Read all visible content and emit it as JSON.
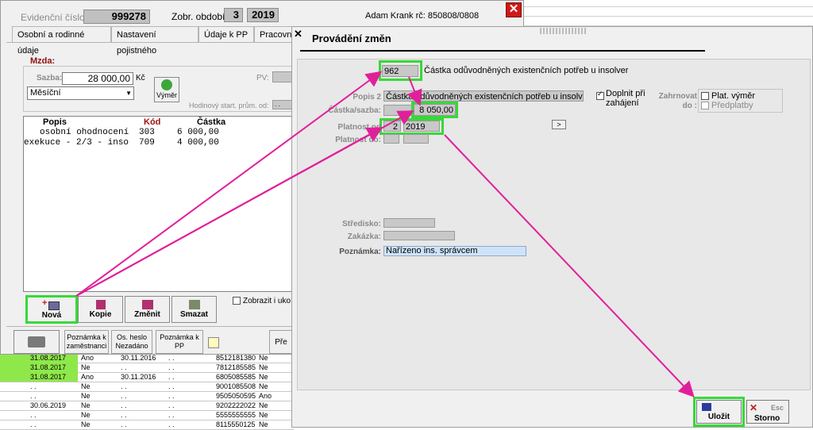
{
  "background": {
    "rows": [
      {
        "c1": "31.08.2017",
        "c2": "Ano",
        "c3": "30.11.2016",
        "c4": ". .",
        "c5": "8512181380",
        "c6": "Ne",
        "green": true
      },
      {
        "c1": "31.08.2017",
        "c2": "Ne",
        "c3": ". .",
        "c4": ". .",
        "c5": "7812185585",
        "c6": "Ne",
        "green": true
      },
      {
        "c1": "31.08.2017",
        "c2": "Ano",
        "c3": "30.11.2016",
        "c4": ". .",
        "c5": "6805085585",
        "c6": "Ne",
        "green": true
      },
      {
        "c1": ". .",
        "c2": "Ne",
        "c3": ". .",
        "c4": ". .",
        "c5": "9001085508",
        "c6": "Ne",
        "green": false
      },
      {
        "c1": ". .",
        "c2": "Ne",
        "c3": ". .",
        "c4": ". .",
        "c5": "9505050595",
        "c6": "Ano",
        "green": false
      },
      {
        "c1": "30.06.2019",
        "c2": "Ne",
        "c3": ". .",
        "c4": ". .",
        "c5": "9202222022",
        "c6": "Ne",
        "green": false
      },
      {
        "c1": ". .",
        "c2": "Ne",
        "c3": ". .",
        "c4": ". .",
        "c5": "5555555555",
        "c6": "Ne",
        "green": false
      },
      {
        "c1": ". .",
        "c2": "Ne",
        "c3": ". .",
        "c4": ". .",
        "c5": "8115550125",
        "c6": "Ne",
        "green": false
      }
    ]
  },
  "employee": {
    "evidence_label": "Evidenční číslo:",
    "evidence_number": "999278",
    "period_label": "Zobr. období:",
    "period_month": "3",
    "period_year": "2019",
    "person": "Adam Krank rč: 850808/0808"
  },
  "tabs": [
    "Osobní a rodinné údaje",
    "Nastavení pojistného",
    "Údaje k PP",
    "Pracovn"
  ],
  "mzda": {
    "title": "Mzda:",
    "rate_label": "Sazba:",
    "rate_value": "28 000,00",
    "currency": "Kč",
    "type_value": "Měsíční",
    "vymer_button": "Výměr",
    "pv_label": "PV:",
    "hourly_label": "Hodinový start. prům. od:",
    "hourly_value": ". ."
  },
  "items": {
    "headers": {
      "popis": "Popis",
      "kod": "Kód",
      "castka": "Částka"
    },
    "rows": [
      {
        "popis": "osobní ohodnocení",
        "kod": "303",
        "castka": "6 000,00"
      },
      {
        "popis": "exekuce - 2/3 - inso",
        "kod": "709",
        "castka": "4 000,00"
      }
    ]
  },
  "actions": {
    "new": "Nová",
    "copy": "Kopie",
    "change": "Změnit",
    "delete": "Smazat",
    "show_checkbox": "Zobrazit i uko"
  },
  "bottom_buttons": {
    "note_employee": "Poznámka k zaměstnanci",
    "password": "Os. heslo Nezadáno",
    "note_pp": "Poznámka k PP",
    "extra": "Pře"
  },
  "dialog": {
    "title": "Provádění změn",
    "code": "962",
    "code_desc": "Částka odůvodněných existenčních potřeb u insolver",
    "popis2_label": "Popis 2",
    "popis2_value": "Částka odůvodněných existenčních potřeb u insolve",
    "amount_label": "Částka/sazba:",
    "amount_value": "8 050,00",
    "valid_from_label": "Platnost od",
    "valid_from_month": "2",
    "valid_from_year": "2019",
    "valid_to_label": "Platnost do:",
    "next_button": ">",
    "doplnit_label": "Doplnit při zahájení",
    "zahrnovat_label": "Zahrnovat do :",
    "plat_vymer": "Plat. výměr",
    "predplatby": "Předplatby",
    "stredisko_label": "Středisko:",
    "zakazka_label": "Zakázka:",
    "poznamka_label": "Poznámka:",
    "poznamka_value": "Nařízeno ins. správcem",
    "save_button": "Uložit",
    "esc_label": "Esc",
    "cancel_button": "Storno"
  },
  "colors": {
    "highlight": "#38d838",
    "arrow": "#e0209a",
    "green_cell": "#8fe84a",
    "close_red": "#d01818"
  }
}
